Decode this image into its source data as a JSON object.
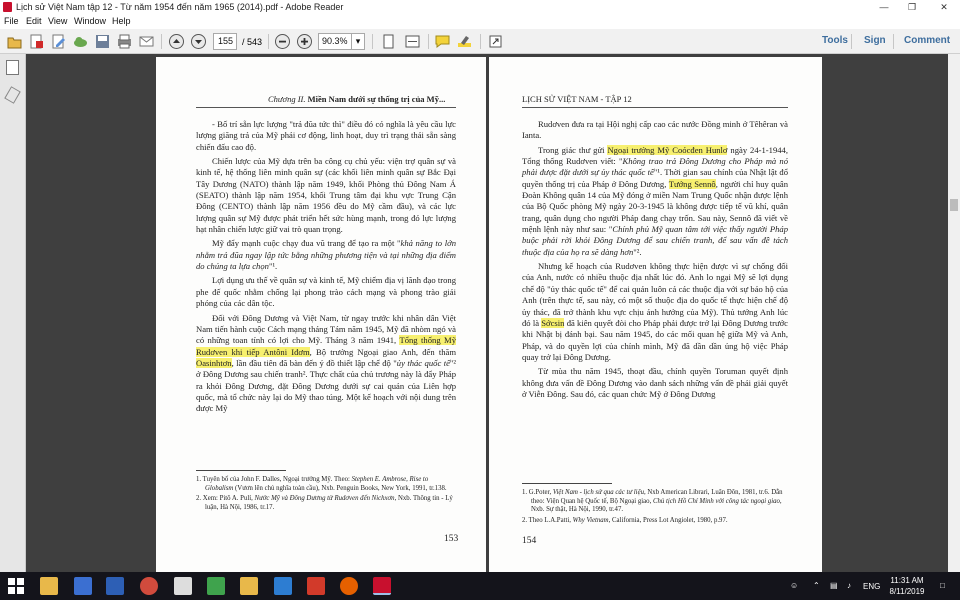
{
  "window": {
    "title": "Lịch sử Việt Nam tập 12 - Từ năm 1954 đến năm 1965 (2014).pdf - Adobe Reader"
  },
  "menu": [
    "File",
    "Edit",
    "View",
    "Window",
    "Help"
  ],
  "toolbar": {
    "page_value": "155",
    "page_total": "/ 543",
    "zoom_value": "90.3%",
    "tools_label": "Tools",
    "sign_label": "Sign",
    "comment_label": "Comment"
  },
  "left_page": {
    "running_head": "Chương II.",
    "running_head_bold": "Miền Nam dưới sự thống trị của Mỹ...",
    "paragraphs": [
      [
        {
          "t": "- Bố trí sẵn lực lượng \"trả đũa tức thì\" điều đó có nghĩa là yêu cầu lực lượng giăng trả của Mỹ phải cơ động, linh hoạt, duy trì trạng thái sẵn sàng chiến đấu cao độ."
        }
      ],
      [
        {
          "t": "Chiến lược của Mỹ dựa trên ba công cụ chủ yếu: viện trợ quân sự và kinh tế, hệ thống liên minh quân sự (các khối liên minh quân sự Bắc Đại Tây Dương (NATO) thành lập năm 1949, khối Phòng thủ Đông Nam Á (SEATO) thành lập năm 1954, khối Trung tâm đại khu vực Trung Cận Đông (CENTO) thành lập năm 1956 đều do Mỹ cầm đầu), và các lực lượng quân sự Mỹ được phát triển hết sức hùng mạnh, trong đó lực lượng hạt nhân chiến lược giữ vai trò quan trọng."
        }
      ],
      [
        {
          "t": "Mỹ đẩy mạnh cuộc chạy đua vũ trang để tạo ra một \""
        },
        {
          "t": "khả năng to lớn nhằm trả đũa ngay lập tức bằng những phương tiện và tại những địa điểm do chúng ta lựa chọn",
          "i": true
        },
        {
          "t": "\"¹."
        }
      ],
      [
        {
          "t": "Lợi dụng ưu thế về quân sự và kinh tế, Mỹ chiếm địa vị lãnh đạo trong phe đế quốc nhằm chống lại phong trào cách mạng và phong trào giải phóng của các dân tộc."
        }
      ],
      [
        {
          "t": "Đối với Đông Dương và Việt Nam, từ ngay trước khi nhân dân Việt Nam tiến hành cuộc Cách mạng tháng Tám năm 1945, Mỹ đã nhòm ngó và có những toan tính có lợi cho Mỹ. Tháng 3 năm 1941, "
        },
        {
          "t": "Tổng thống Mỹ Rudơven khi tiếp Antôni Iđơm",
          "h": true
        },
        {
          "t": ", Bộ trưởng Ngoại giao Anh, đến thăm "
        },
        {
          "t": "Oasinhtơn",
          "h": true
        },
        {
          "t": ", lần đầu tiên đã bàn đến ý đồ thiết lập chế độ \""
        },
        {
          "t": "ủy thác quốc tế",
          "i": true
        },
        {
          "t": "\"² ở Đông Dương sau chiến tranh². Thực chất của chủ trương này là đẩy Pháp ra khỏi Đông Dương, đặt Đông Dương dưới sự cai quản của Liên hợp quốc, mà tổ chức này lại do Mỹ thao túng. Một kế hoạch với nội dung trên được Mỹ"
        }
      ]
    ],
    "footnotes": [
      [
        {
          "t": "1. Tuyên bố của John F. Dalles, Ngoại trưởng Mỹ. Theo: "
        },
        {
          "t": "Stephen E. Ambrose, Rise to Globalism",
          "i": true
        },
        {
          "t": " (Vươn lên chủ nghĩa toàn cầu), Nxb. Penguin Books, New York, 1991, tr.138."
        }
      ],
      [
        {
          "t": "2. Xem: Pitô A. Pulí, "
        },
        {
          "t": "Nước Mỹ và Đông Dương từ Rudơven đến Nichxơn",
          "i": true
        },
        {
          "t": ", Nxb. Thông tin - Lý luận, Hà Nội, 1986, tr.17."
        }
      ]
    ],
    "page_number": "153"
  },
  "right_page": {
    "running_head": "LỊCH SỬ VIỆT NAM - TẬP 12",
    "paragraphs": [
      [
        {
          "t": "Rudơven đưa ra tại Hội nghị cấp cao các nước Đồng minh ở Têhêran và Ianta."
        }
      ],
      [
        {
          "t": "Trong giác thư gửi "
        },
        {
          "t": "Ngoại trưởng Mỹ Coócđen Hunlơ",
          "h": true
        },
        {
          "t": " ngày 24-1-1944, Tổng thống Rudơven viết: \""
        },
        {
          "t": "Không trao trả Đông Dương cho Pháp mà nó phải được đặt dưới sự ủy thác quốc tế",
          "i": true
        },
        {
          "t": "\"¹. Thời gian sau chính của Nhật lật đổ quyền thống trị của Pháp ở Đông Dương, "
        },
        {
          "t": "Tướng Sennô",
          "h": true
        },
        {
          "t": ", người chỉ huy quân Đoàn Không quân 14 của Mỹ đóng ở miền Nam Trung Quốc nhận được lệnh của Bộ Quốc phòng Mỹ ngày 20-3-1945 là không được tiếp tế vũ khí, quân trang, quân dụng cho người Pháp đang chạy trốn. Sau này, Sennô đã viết về mệnh lệnh này như sau: \""
        },
        {
          "t": "Chính phủ Mỹ quan tâm tới việc thấy người Pháp buộc phải rời khỏi Đông Dương để sau chiến tranh, để sau vấn đề tách thuộc địa của họ ra sẽ dàng hơn",
          "i": true
        },
        {
          "t": "\"²."
        }
      ],
      [
        {
          "t": "Nhưng kế hoạch của Rudơven không thực hiện được vì sự chống đối của Anh, nước có nhiều thuộc địa nhất lúc đó. Anh lo ngại Mỹ sẽ lợi dụng chế độ \"ủy thác quốc tế\" để cai quản luôn cả các thuộc địa với sự bảo hộ của Anh (trên thực tế, sau này, có một số thuộc địa do quốc tế thực hiện chế độ ủy thác, đã trở thành khu vực chịu ảnh hưởng của Mỹ). Thủ tướng Anh lúc đó là "
        },
        {
          "t": "Sớcsin",
          "h": true
        },
        {
          "t": " đã kiên quyết đòi cho Pháp phải được trở lại Đông Dương trước khi Nhật bị đánh bại. Sau năm 1945, do các mối quan hệ giữa Mỹ và Anh, Pháp, và do quyền lợi của chính mình, Mỹ đã dần dần ủng hộ việc Pháp quay trở lại Đông Dương."
        }
      ],
      [
        {
          "t": "Từ mùa thu năm 1945, thoạt đầu, chính quyền Toruman quyết định không đưa vấn đề Đông Dương vào danh sách những vấn đề phải giải quyết ở Viễn Đông. Sau đó, các quan chức Mỹ ở Đông Dương"
        }
      ]
    ],
    "footnotes": [
      [
        {
          "t": "1. G.Poter, "
        },
        {
          "t": "Việt Nam - lịch sử qua các tư liệu",
          "i": true
        },
        {
          "t": ", Nxb American Librari, Luân Đôn, 1981, tr.6. Dẫn theo: Viện Quan hệ Quốc tế, Bộ Ngoại giao, "
        },
        {
          "t": "Chủ tịch Hồ Chí Minh với công tác ngoại giao",
          "i": true
        },
        {
          "t": ", Nxb. Sự thật, Hà Nội, 1990, tr.47."
        }
      ],
      [
        {
          "t": "2. Theo L.A.Patti, "
        },
        {
          "t": "Why Vietnam",
          "i": true
        },
        {
          "t": ", California, Press Lot Angiolet, 1980, p.97."
        }
      ]
    ],
    "page_number": "154"
  },
  "taskbar": {
    "time": "11:31 AM",
    "date": "8/11/2019",
    "lang": "ENG"
  }
}
